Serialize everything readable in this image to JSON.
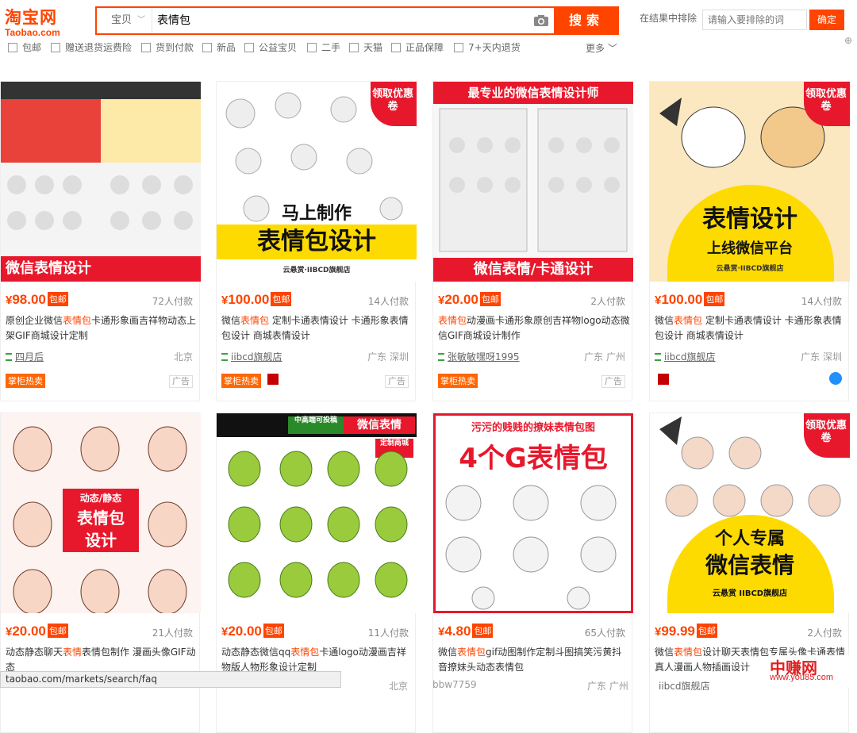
{
  "header": {
    "logo_cn": "淘宝网",
    "logo_en": "Taobao.com",
    "search_type": "宝贝",
    "search_query": "表情包",
    "search_button": "搜索",
    "exclude_label": "在结果中排除",
    "exclude_placeholder": "请输入要排除的词",
    "exclude_button": "确定"
  },
  "filters": [
    "包邮",
    "赠送退货运费险",
    "货到付款",
    "新品",
    "公益宝贝",
    "二手",
    "天猫",
    "正品保障",
    "7+天内退货"
  ],
  "more_label": "更多",
  "items": [
    {
      "price": "98.00",
      "badge": "包邮",
      "sales": "72人付款",
      "title_pre": "原创企业微信",
      "title_hl": "表情包",
      "title_post": "卡通形象画吉祥物动态上架GIF商城设计定制",
      "shop": "四月后",
      "loc": "北京",
      "tag": "掌柜热卖",
      "ad": "广告",
      "banner": "微信表情设计",
      "banner2": "",
      "banner3": "",
      "badge_top": ""
    },
    {
      "price": "100.00",
      "badge": "包邮",
      "sales": "14人付款",
      "title_pre": "微信",
      "title_hl": "表情包",
      "title_post": " 定制卡通表情设计 卡通形象表情包设计 商城表情设计",
      "shop": "iibcd旗舰店",
      "loc": "广东 深圳",
      "tag": "掌柜热卖",
      "ad": "广告",
      "banner": "表情包设计",
      "banner2": "马上制作",
      "banner3": "云悬赏·IIBCD旗舰店",
      "badge_top": "领取优惠卷"
    },
    {
      "price": "20.00",
      "badge": "包邮",
      "sales": "2人付款",
      "title_pre": "",
      "title_hl": "表情包",
      "title_post": "动漫画卡通形象原创吉祥物logo动态微信GIF商城设计制作",
      "shop": "张敏敏嘿呀1995",
      "loc": "广东 广州",
      "tag": "掌柜热卖",
      "ad": "广告",
      "banner": "微信表情/卡通设计",
      "banner2": "最专业的微信表情设计师",
      "banner3": "",
      "badge_top": ""
    },
    {
      "price": "100.00",
      "badge": "包邮",
      "sales": "14人付款",
      "title_pre": "微信",
      "title_hl": "表情包",
      "title_post": " 定制卡通表情设计 卡通形象表情包设计 商城表情设计",
      "shop": "iibcd旗舰店",
      "loc": "广东 深圳",
      "tag": "",
      "ad": "",
      "banner": "表情设计",
      "banner2": "上线微信平台",
      "banner3": "云悬赏·IIBCD旗舰店",
      "badge_top": "领取优惠卷"
    },
    {
      "price": "20.00",
      "badge": "包邮",
      "sales": "21人付款",
      "title_pre": "动态静态聊天",
      "title_hl": "表情",
      "title_post": "表情包制作 漫画头像GIF动态",
      "shop": "",
      "loc": "",
      "tag": "",
      "ad": "",
      "banner": "表情包",
      "banner2": "动态/静态",
      "banner3": "设计",
      "badge_top": ""
    },
    {
      "price": "20.00",
      "badge": "包邮",
      "sales": "11人付款",
      "title_pre": "动态静态微信qq",
      "title_hl": "表情包",
      "title_post": "卡通logo动漫画吉祥物版人物形象设计定制",
      "shop": "",
      "loc": "北京",
      "tag": "",
      "ad": "",
      "banner": "微信表情",
      "banner2": "中高端可投稿",
      "banner3": "定制商城",
      "badge_top": ""
    },
    {
      "price": "4.80",
      "badge": "包邮",
      "sales": "65人付款",
      "title_pre": "微信",
      "title_hl": "表情包",
      "title_post": "gif动图制作定制斗图搞笑污黄抖音撩妹头动态表情包",
      "shop": "bbw7759",
      "loc": "广东 广州",
      "tag": "",
      "ad": "",
      "banner": "4个G表情包",
      "banner2": "污污的贱贱的撩妹表情包图",
      "banner3": "",
      "badge_top": ""
    },
    {
      "price": "99.99",
      "badge": "包邮",
      "sales": "2人付款",
      "title_pre": "微信",
      "title_hl": "表情包",
      "title_post": "设计聊天表情包专属头像卡通表情真人漫画人物插画设计",
      "shop": "iibcd旗舰店",
      "loc": "",
      "tag": "",
      "ad": "",
      "banner": "微信表情",
      "banner2": "个人专属",
      "banner3": "云悬赏 IIBCD旗舰店",
      "badge_top": "领取优惠卷"
    }
  ],
  "status_url": "taobao.com/markets/search/faq",
  "watermark": "中赚网",
  "watermark_url": "www.you85.com"
}
